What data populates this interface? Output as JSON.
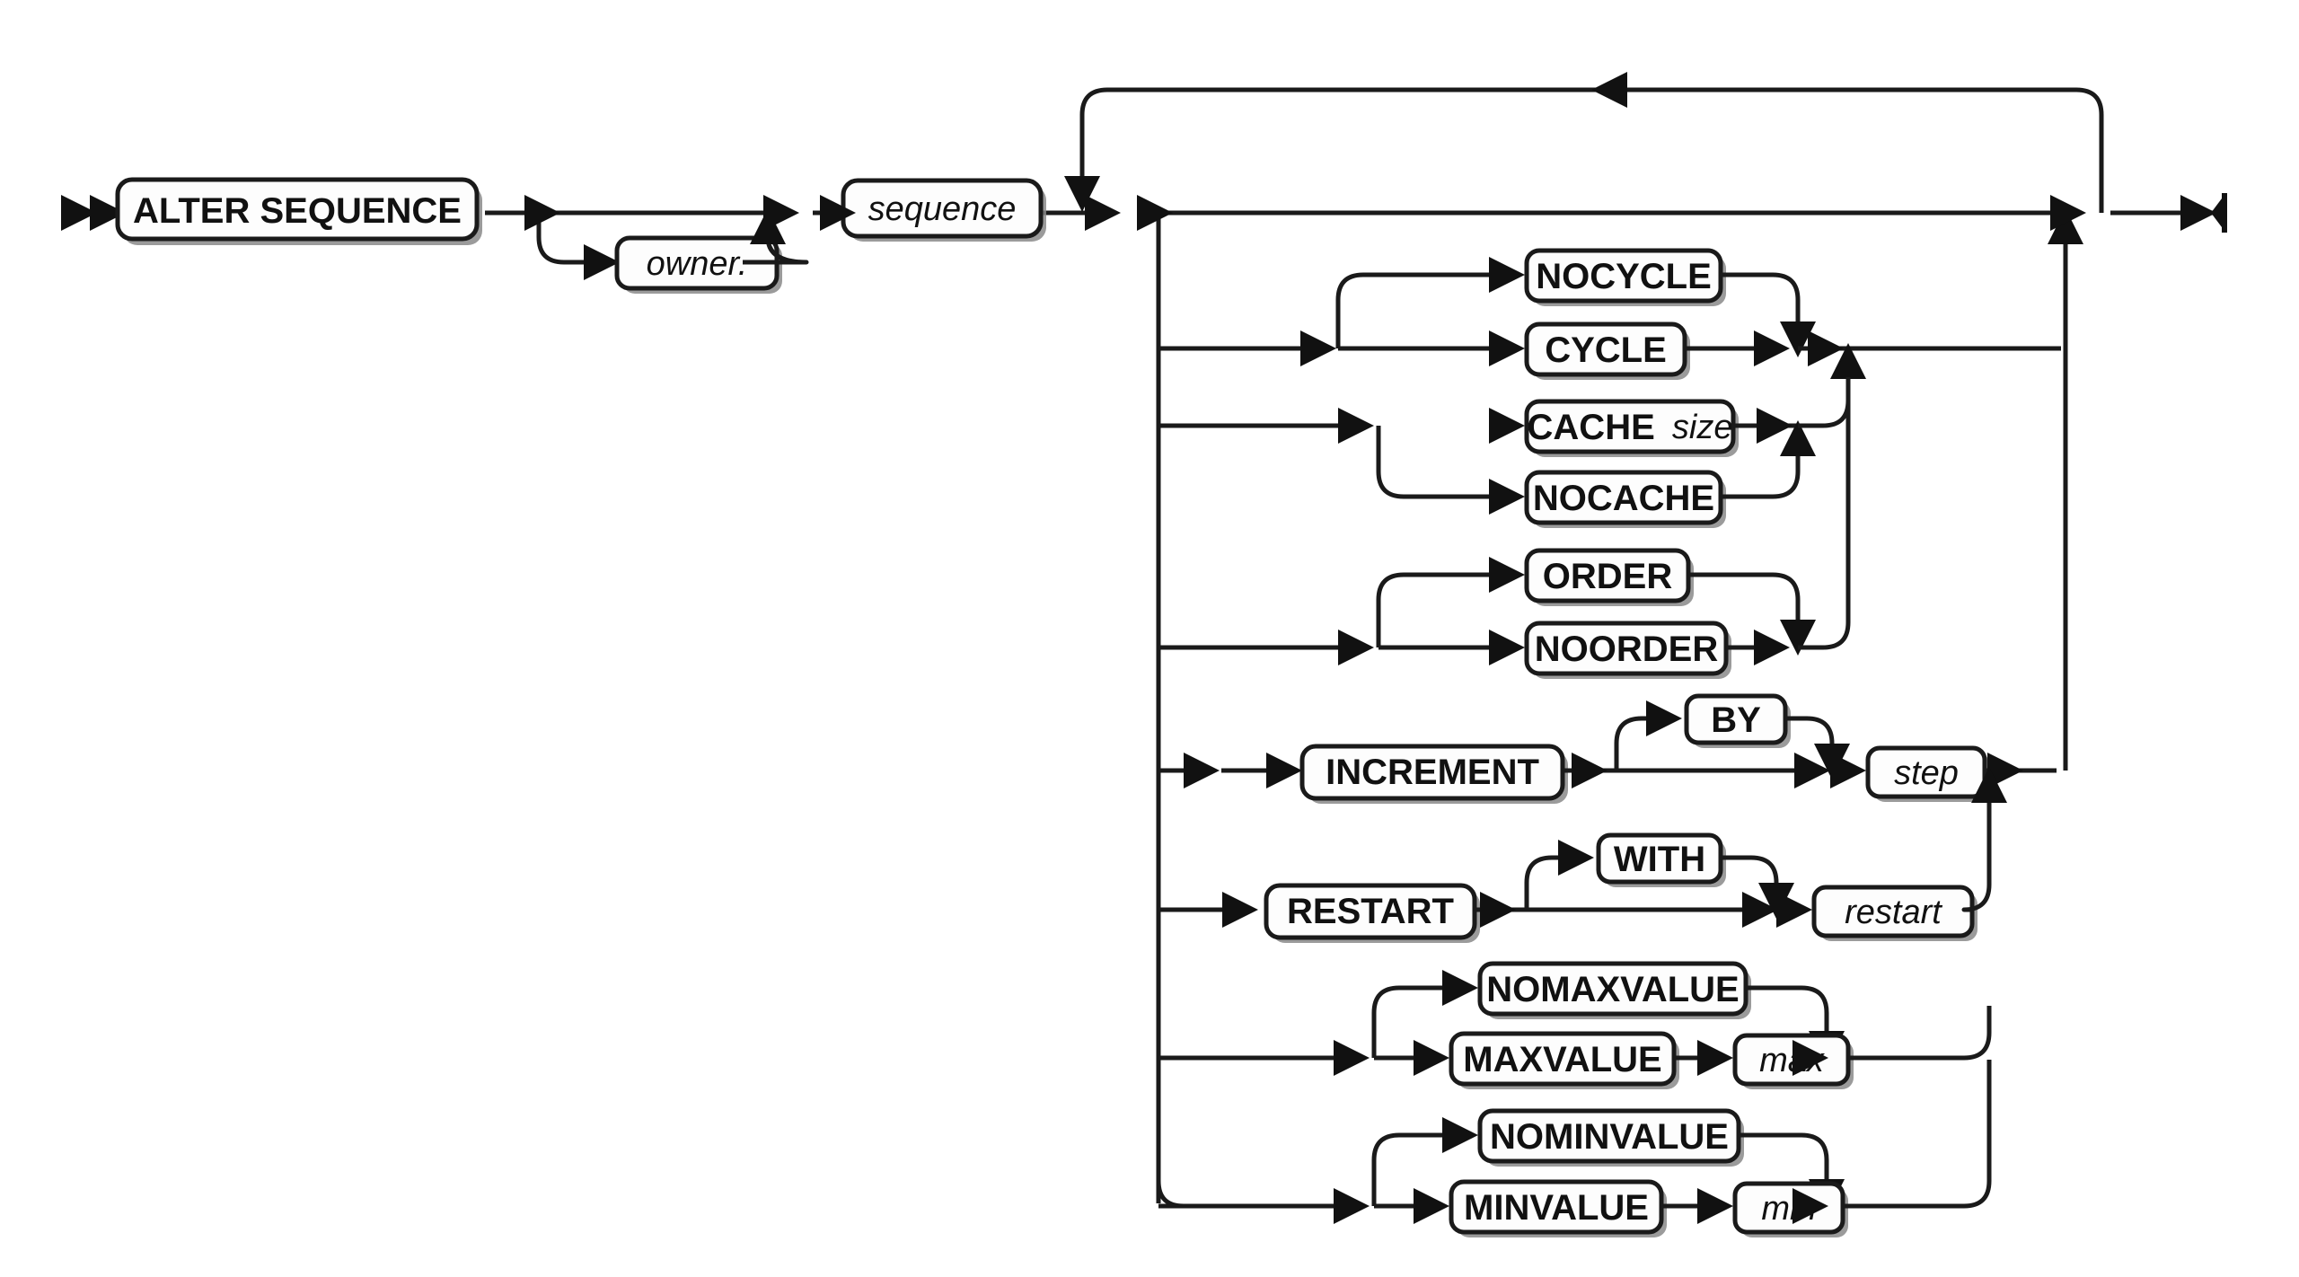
{
  "diagram": {
    "title": "ALTER SEQUENCE",
    "type": "railroad-syntax-diagram",
    "colors": {
      "line": "#1a1a1a",
      "box_fill": "#fdfdfd",
      "box_stroke": "#1a1a1a",
      "shadow": "#8a8a8a",
      "background": "#ffffff",
      "text": "#111111"
    },
    "terminators": {
      "start": "double-right-arrow",
      "end": "arrow-bar"
    },
    "nodes": {
      "alter_sequence": {
        "label": "ALTER SEQUENCE",
        "kind": "keyword"
      },
      "owner": {
        "label": "owner.",
        "kind": "variable"
      },
      "sequence": {
        "label": "sequence",
        "kind": "variable"
      },
      "nocycle": {
        "label": "NOCYCLE",
        "kind": "keyword"
      },
      "cycle": {
        "label": "CYCLE",
        "kind": "keyword"
      },
      "cache_size": {
        "label": "CACHE size",
        "keyword_part": "CACHE ",
        "variable_part": "size",
        "kind": "keyword-variable"
      },
      "nocache": {
        "label": "NOCACHE",
        "kind": "keyword"
      },
      "order": {
        "label": "ORDER",
        "kind": "keyword"
      },
      "noorder": {
        "label": "NOORDER",
        "kind": "keyword"
      },
      "increment": {
        "label": "INCREMENT",
        "kind": "keyword"
      },
      "by": {
        "label": "BY",
        "kind": "keyword"
      },
      "step": {
        "label": "step",
        "kind": "variable"
      },
      "restart": {
        "label": "RESTART",
        "kind": "keyword"
      },
      "with": {
        "label": "WITH",
        "kind": "keyword"
      },
      "restart_value": {
        "label": "restart",
        "kind": "variable"
      },
      "nomaxvalue": {
        "label": "NOMAXVALUE",
        "kind": "keyword"
      },
      "maxvalue": {
        "label": "MAXVALUE",
        "kind": "keyword"
      },
      "max": {
        "label": "max",
        "kind": "variable"
      },
      "nominvalue": {
        "label": "NOMINVALUE",
        "kind": "keyword"
      },
      "minvalue": {
        "label": "MINVALUE",
        "kind": "keyword"
      },
      "min": {
        "label": "min",
        "kind": "variable"
      }
    }
  }
}
